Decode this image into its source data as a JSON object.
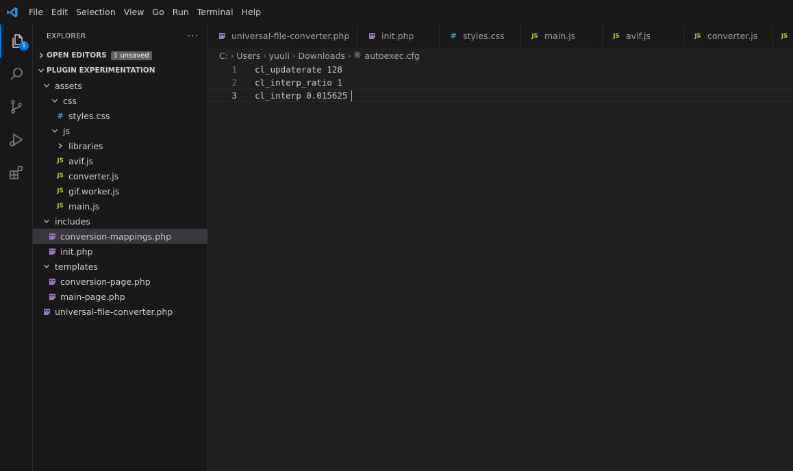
{
  "menubar": {
    "items": [
      "File",
      "Edit",
      "Selection",
      "View",
      "Go",
      "Run",
      "Terminal",
      "Help"
    ]
  },
  "activitybar": {
    "icons": [
      "explorer-icon",
      "search-icon",
      "source-control-icon",
      "run-debug-icon",
      "extensions-icon"
    ],
    "explorer_badge": "1"
  },
  "sidebar": {
    "title": "EXPLORER",
    "more": "···",
    "open_editors": {
      "label": "OPEN EDITORS",
      "badge": "1 unsaved"
    },
    "project": {
      "label": "PLUGIN EXPERIMENTATION"
    },
    "tree": [
      {
        "label": "assets",
        "kind": "folder-open"
      },
      {
        "label": "css",
        "kind": "folder-open"
      },
      {
        "label": "styles.css",
        "kind": "css"
      },
      {
        "label": "js",
        "kind": "folder-open"
      },
      {
        "label": "libraries",
        "kind": "folder-closed"
      },
      {
        "label": "avif.js",
        "kind": "js"
      },
      {
        "label": "converter.js",
        "kind": "js"
      },
      {
        "label": "gif.worker.js",
        "kind": "js"
      },
      {
        "label": "main.js",
        "kind": "js"
      },
      {
        "label": "includes",
        "kind": "folder-open"
      },
      {
        "label": "conversion-mappings.php",
        "kind": "php"
      },
      {
        "label": "init.php",
        "kind": "php"
      },
      {
        "label": "templates",
        "kind": "folder-open"
      },
      {
        "label": "conversion-page.php",
        "kind": "php"
      },
      {
        "label": "main-page.php",
        "kind": "php"
      },
      {
        "label": "universal-file-converter.php",
        "kind": "php"
      }
    ]
  },
  "tabs": [
    {
      "label": "universal-file-converter.php",
      "kind": "php"
    },
    {
      "label": "init.php",
      "kind": "php"
    },
    {
      "label": "styles.css",
      "kind": "css"
    },
    {
      "label": "main.js",
      "kind": "js"
    },
    {
      "label": "avif.js",
      "kind": "js"
    },
    {
      "label": "converter.js",
      "kind": "js"
    },
    {
      "label": "",
      "kind": "js"
    }
  ],
  "breadcrumb": {
    "parts": [
      "C:",
      "Users",
      "yuuli",
      "Downloads"
    ],
    "file": "autoexec.cfg"
  },
  "editor": {
    "lines": [
      {
        "no": "1",
        "text": "cl_updaterate 128"
      },
      {
        "no": "2",
        "text": "cl_interp_ratio 1"
      },
      {
        "no": "3",
        "text": "cl_interp 0.015625"
      }
    ]
  },
  "colors": {
    "php_icon": "#a074c4",
    "js_icon": "#cbcb41",
    "css_icon": "#519aba",
    "accent": "#0078d4"
  }
}
